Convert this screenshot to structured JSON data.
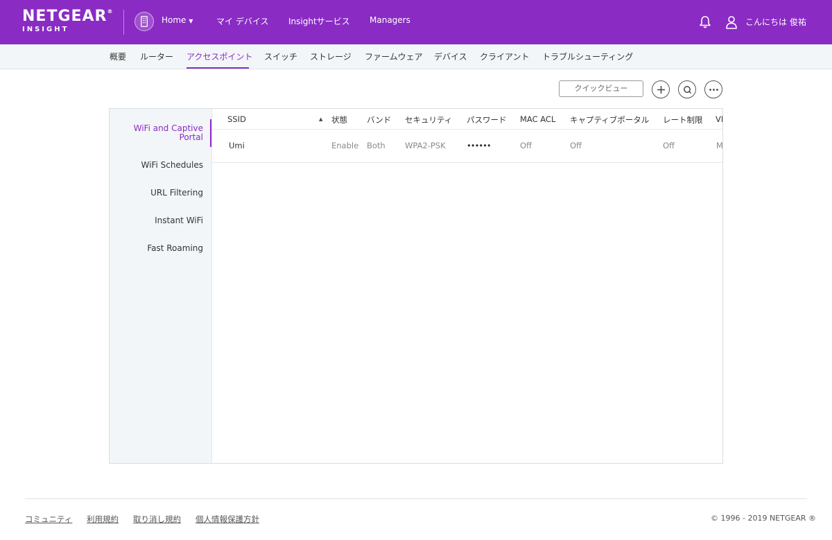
{
  "header": {
    "logo_line1": "NETGEAR",
    "logo_registered": "®",
    "logo_line2": "INSIGHT",
    "home_label": "Home",
    "nav": [
      "マイ デバイス",
      "Insightサービス",
      "Managers"
    ],
    "greeting": "こんにちは 俊祐",
    "icons": {
      "home": "building-icon",
      "dropdown": "caret-down-icon",
      "bell": "bell-icon",
      "user": "user-icon"
    }
  },
  "subnav": {
    "tabs": [
      "概要",
      "ルーター",
      "アクセスポイント",
      "スイッチ",
      "ストレージ",
      "ファームウェア",
      "デバイス",
      "クライアント",
      "トラブルシューティング"
    ],
    "active_index": 2
  },
  "toolbar": {
    "quick_view_label": "クイックビュー",
    "icons": {
      "add": "plus-icon",
      "search": "search-icon",
      "more": "more-icon"
    }
  },
  "sidebar": {
    "items": [
      {
        "label_line1": "WiFi and Captive",
        "label_line2": "Portal"
      },
      {
        "label_line1": "WiFi Schedules"
      },
      {
        "label_line1": "URL Filtering"
      },
      {
        "label_line1": "Instant WiFi"
      },
      {
        "label_line1": "Fast Roaming"
      }
    ],
    "active_index": 0
  },
  "table": {
    "columns": [
      "SSID",
      "状態",
      "バンド",
      "セキュリティ",
      "パスワード",
      "MAC ACL",
      "キャプティブポータル",
      "レート制限",
      "VL"
    ],
    "sort_icon": "sort-asc-icon",
    "rows": [
      {
        "ssid": "Umi",
        "status": "Enable",
        "band": "Both",
        "security": "WPA2-PSK",
        "password": "••••••",
        "mac_acl": "Off",
        "captive_portal": "Off",
        "rate_limit": "Off",
        "vlan": "M"
      }
    ]
  },
  "footer": {
    "links": [
      "コミュニティ",
      "利用規約",
      "取り消し規約",
      "個人情報保護方針"
    ],
    "copyright": "© 1996 - 2019 NETGEAR ®"
  },
  "colors": {
    "brand": "#8a2bc4",
    "subnav_bg": "#f3f6f8"
  }
}
